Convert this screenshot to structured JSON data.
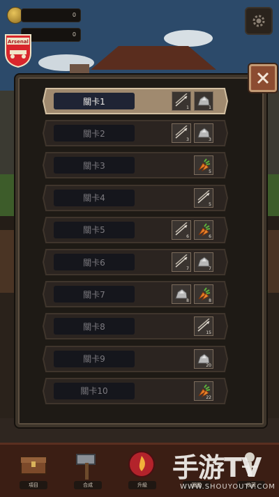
{
  "currency": {
    "gold": "0",
    "gems": "0"
  },
  "badge_text": "Arsenal",
  "stages": [
    {
      "label": "關卡1",
      "items": [
        {
          "icon": "arrows-icon",
          "qty": "1"
        },
        {
          "icon": "stone-icon",
          "qty": "1"
        }
      ]
    },
    {
      "label": "關卡2",
      "items": [
        {
          "icon": "arrows-icon",
          "qty": "3"
        },
        {
          "icon": "stone-icon",
          "qty": "3"
        }
      ]
    },
    {
      "label": "關卡3",
      "items": [
        {
          "icon": "carrot-icon",
          "qty": "5"
        }
      ]
    },
    {
      "label": "關卡4",
      "items": [
        {
          "icon": "arrows-icon",
          "qty": "5"
        }
      ]
    },
    {
      "label": "關卡5",
      "items": [
        {
          "icon": "arrows-icon",
          "qty": "6"
        },
        {
          "icon": "carrot-icon",
          "qty": "6"
        }
      ]
    },
    {
      "label": "關卡6",
      "items": [
        {
          "icon": "arrows-icon",
          "qty": "7"
        },
        {
          "icon": "stone-icon",
          "qty": "7"
        }
      ]
    },
    {
      "label": "關卡7",
      "items": [
        {
          "icon": "stone-icon",
          "qty": "8"
        },
        {
          "icon": "carrot-icon",
          "qty": "8"
        }
      ]
    },
    {
      "label": "關卡8",
      "items": [
        {
          "icon": "arrows-icon",
          "qty": "15"
        }
      ]
    },
    {
      "label": "關卡9",
      "items": [
        {
          "icon": "stone-icon",
          "qty": "20"
        }
      ]
    },
    {
      "label": "關卡10",
      "items": [
        {
          "icon": "carrot-icon",
          "qty": "22"
        }
      ]
    }
  ],
  "nav": [
    "項目",
    "合成",
    "升級",
    "圖鑑",
    "收藏"
  ],
  "watermark": {
    "main": "手游TV",
    "url": "WWW.SHOUYOUTV.COM"
  },
  "colors": {
    "active_label_text": "#f2f0ec",
    "inactive_label_text": "#7d7b80",
    "close_button": "#8c4c31"
  }
}
